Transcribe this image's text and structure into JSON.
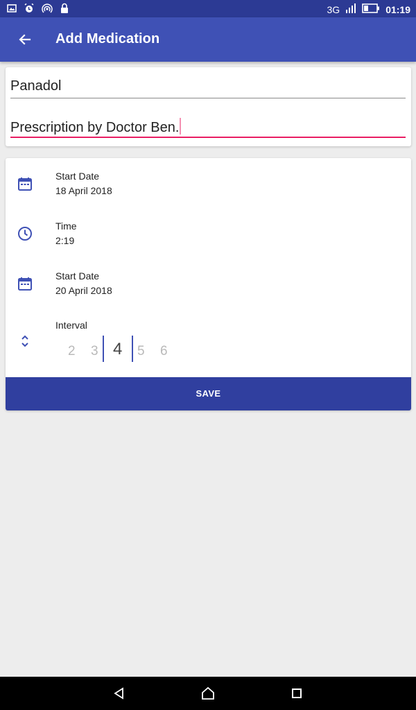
{
  "status_bar": {
    "icons": [
      "image-icon",
      "alarm-icon",
      "hotspot-icon",
      "lock-icon"
    ],
    "network": "3G",
    "network_small": "3G",
    "time": "01:19"
  },
  "app_bar": {
    "title": "Add Medication"
  },
  "form": {
    "name_value": "Panadol",
    "note_value": "Prescription by Doctor Ben."
  },
  "schedule": {
    "start_date": {
      "label": "Start Date",
      "value": "18 April 2018",
      "icon": "calendar-icon"
    },
    "time": {
      "label": "Time",
      "value": "2:19",
      "icon": "clock-icon"
    },
    "end_date": {
      "label": "Start Date",
      "value": "20 April 2018",
      "icon": "calendar-icon"
    },
    "interval": {
      "label": "Interval",
      "icon": "unfold-icon",
      "options": [
        "2",
        "3",
        "4",
        "5",
        "6"
      ],
      "selected": "4"
    }
  },
  "actions": {
    "save_label": "SAVE"
  },
  "colors": {
    "primary": "#3f51b5",
    "primary_dark": "#2c3a94",
    "button": "#303f9f",
    "accent": "#e91e63"
  }
}
